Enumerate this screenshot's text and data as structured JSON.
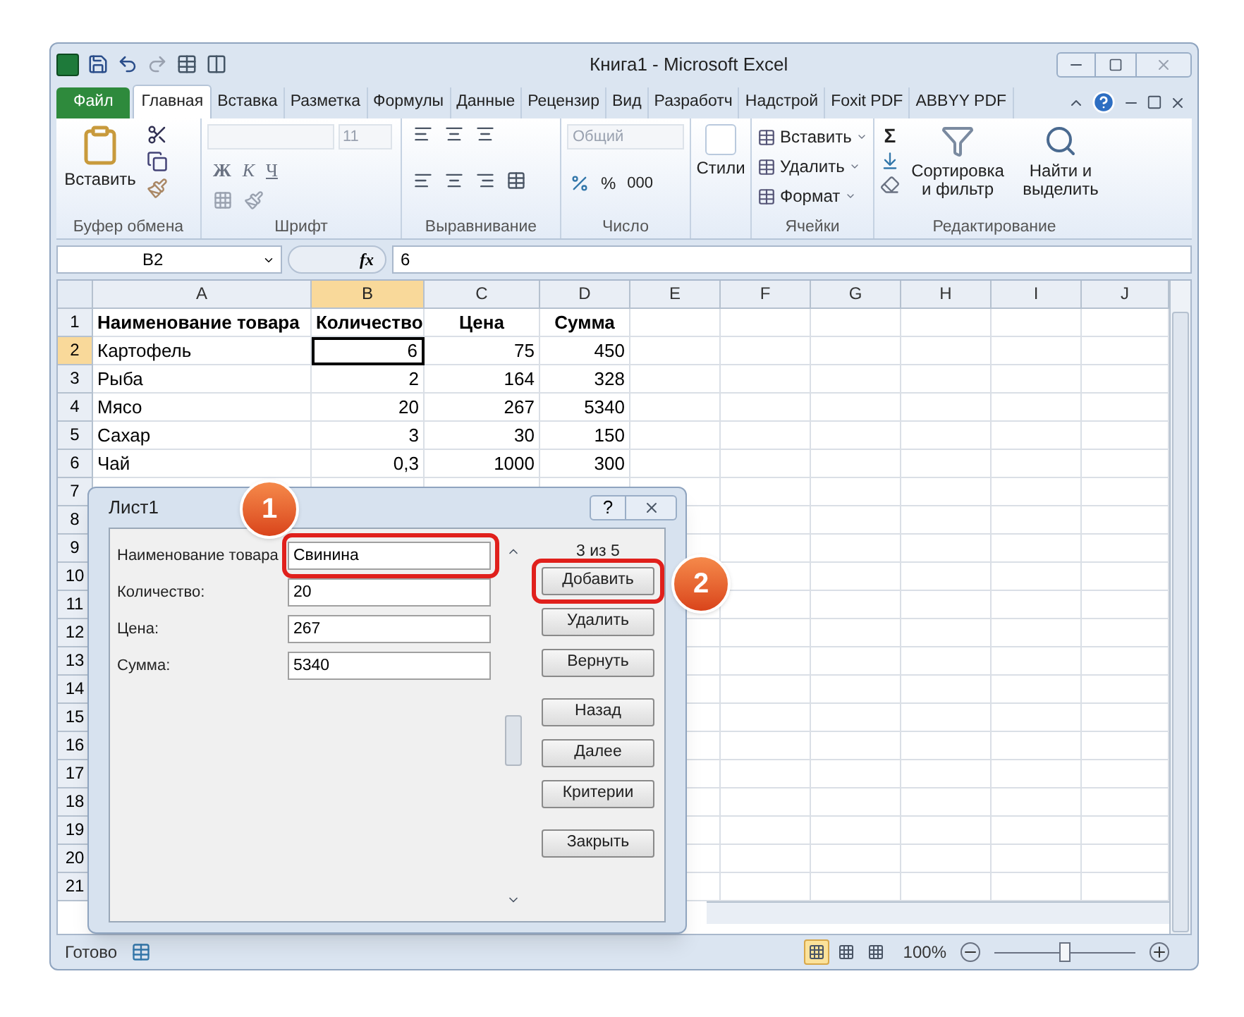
{
  "window": {
    "title": "Книга1 - Microsoft Excel"
  },
  "ribbon_tabs": [
    {
      "label": "Файл",
      "kind": "file",
      "selected": false
    },
    {
      "label": "Главная",
      "kind": "tab",
      "selected": true
    },
    {
      "label": "Вставка",
      "kind": "tab",
      "selected": false
    },
    {
      "label": "Разметка",
      "kind": "tab",
      "selected": false
    },
    {
      "label": "Формулы",
      "kind": "tab",
      "selected": false
    },
    {
      "label": "Данные",
      "kind": "tab",
      "selected": false
    },
    {
      "label": "Рецензир",
      "kind": "tab",
      "selected": false
    },
    {
      "label": "Вид",
      "kind": "tab",
      "selected": false
    },
    {
      "label": "Разработч",
      "kind": "tab",
      "selected": false
    },
    {
      "label": "Надстрой",
      "kind": "tab",
      "selected": false
    },
    {
      "label": "Foxit PDF",
      "kind": "tab",
      "selected": false
    },
    {
      "label": "ABBYY PDF",
      "kind": "tab",
      "selected": false
    }
  ],
  "ribbon": {
    "clipboard": {
      "title": "Буфер обмена",
      "paste": "Вставить"
    },
    "font": {
      "title": "Шрифт",
      "size": "11",
      "bold": "Ж",
      "italic": "К",
      "underline": "Ч"
    },
    "alignment": {
      "title": "Выравнивание"
    },
    "number": {
      "title": "Число",
      "format": "Общий",
      "percent": "%",
      "thousands": "000"
    },
    "styles": {
      "label": "Стили"
    },
    "cells": {
      "title": "Ячейки",
      "buttons": [
        "Вставить",
        "Удалить",
        "Формат"
      ]
    },
    "editing": {
      "title": "Редактирование",
      "sum": "Σ",
      "sort": "Сортировка и фильтр",
      "find": "Найти и выделить"
    }
  },
  "formula_bar": {
    "name_box": "B2",
    "fx": "fx",
    "value": "6"
  },
  "grid": {
    "columns": [
      {
        "label": "A",
        "selected": false
      },
      {
        "label": "B",
        "selected": true
      },
      {
        "label": "C",
        "selected": false
      },
      {
        "label": "D",
        "selected": false
      },
      {
        "label": "E",
        "selected": false
      },
      {
        "label": "F",
        "selected": false
      },
      {
        "label": "G",
        "selected": false
      },
      {
        "label": "H",
        "selected": false
      },
      {
        "label": "I",
        "selected": false
      },
      {
        "label": "J",
        "selected": false
      }
    ],
    "rows": [
      {
        "number": "1",
        "kind": "header",
        "selected": false,
        "cells": [
          {
            "text": "Наименование товара",
            "selected": false
          },
          {
            "text": "Количество",
            "selected": false
          },
          {
            "text": "Цена",
            "selected": false
          },
          {
            "text": "Сумма",
            "selected": false
          }
        ]
      },
      {
        "number": "2",
        "kind": "data",
        "selected": true,
        "cells": [
          {
            "text": "Картофель",
            "selected": false
          },
          {
            "text": "6",
            "selected": true
          },
          {
            "text": "75",
            "selected": false
          },
          {
            "text": "450",
            "selected": false
          }
        ]
      },
      {
        "number": "3",
        "kind": "data",
        "selected": false,
        "cells": [
          {
            "text": "Рыба",
            "selected": false
          },
          {
            "text": "2",
            "selected": false
          },
          {
            "text": "164",
            "selected": false
          },
          {
            "text": "328",
            "selected": false
          }
        ]
      },
      {
        "number": "4",
        "kind": "data",
        "selected": false,
        "cells": [
          {
            "text": "Мясо",
            "selected": false
          },
          {
            "text": "20",
            "selected": false
          },
          {
            "text": "267",
            "selected": false
          },
          {
            "text": "5340",
            "selected": false
          }
        ]
      },
      {
        "number": "5",
        "kind": "data",
        "selected": false,
        "cells": [
          {
            "text": "Сахар",
            "selected": false
          },
          {
            "text": "3",
            "selected": false
          },
          {
            "text": "30",
            "selected": false
          },
          {
            "text": "150",
            "selected": false
          }
        ]
      },
      {
        "number": "6",
        "kind": "data",
        "selected": false,
        "cells": [
          {
            "text": "Чай",
            "selected": false
          },
          {
            "text": "0,3",
            "selected": false
          },
          {
            "text": "1000",
            "selected": false
          },
          {
            "text": "300",
            "selected": false
          }
        ]
      },
      {
        "number": "7",
        "kind": "data",
        "selected": false,
        "cells": []
      },
      {
        "number": "8",
        "kind": "data",
        "selected": false,
        "cells": []
      },
      {
        "number": "9",
        "kind": "data",
        "selected": false,
        "cells": []
      },
      {
        "number": "10",
        "kind": "data",
        "selected": false,
        "cells": []
      },
      {
        "number": "11",
        "kind": "data",
        "selected": false,
        "cells": []
      },
      {
        "number": "12",
        "kind": "data",
        "selected": false,
        "cells": []
      },
      {
        "number": "13",
        "kind": "data",
        "selected": false,
        "cells": []
      },
      {
        "number": "14",
        "kind": "data",
        "selected": false,
        "cells": []
      },
      {
        "number": "15",
        "kind": "data",
        "selected": false,
        "cells": []
      },
      {
        "number": "16",
        "kind": "data",
        "selected": false,
        "cells": []
      },
      {
        "number": "17",
        "kind": "data",
        "selected": false,
        "cells": []
      },
      {
        "number": "18",
        "kind": "data",
        "selected": false,
        "cells": []
      },
      {
        "number": "19",
        "kind": "data",
        "selected": false,
        "cells": []
      },
      {
        "number": "20",
        "kind": "data",
        "selected": false,
        "cells": []
      },
      {
        "number": "21",
        "kind": "data",
        "selected": false,
        "cells": []
      }
    ]
  },
  "status_bar": {
    "text": "Готово",
    "views": [
      {
        "selected": true
      },
      {
        "selected": false
      },
      {
        "selected": false
      }
    ],
    "zoom": "100%",
    "level": 0.5
  },
  "dialog": {
    "title": "Лист1",
    "help": "?",
    "fields": [
      {
        "label": "Наименование товара",
        "value": "Свинина",
        "highlighted": true
      },
      {
        "label": "Количество:",
        "value": "20",
        "highlighted": false
      },
      {
        "label": "Цена:",
        "value": "267",
        "highlighted": false
      },
      {
        "label": "Сумма:",
        "value": "5340",
        "highlighted": false
      }
    ],
    "record": "3 из 5",
    "buttons": [
      {
        "label": "Добавить",
        "highlighted": true
      },
      {
        "label": "Удалить",
        "highlighted": false
      },
      {
        "label": "Вернуть",
        "highlighted": false
      },
      {
        "label": "Назад",
        "highlighted": false
      },
      {
        "label": "Далее",
        "highlighted": false
      },
      {
        "label": "Критерии",
        "highlighted": false
      },
      {
        "label": "Закрыть",
        "highlighted": false
      }
    ]
  },
  "callouts": [
    {
      "number": "1"
    },
    {
      "number": "2"
    }
  ]
}
